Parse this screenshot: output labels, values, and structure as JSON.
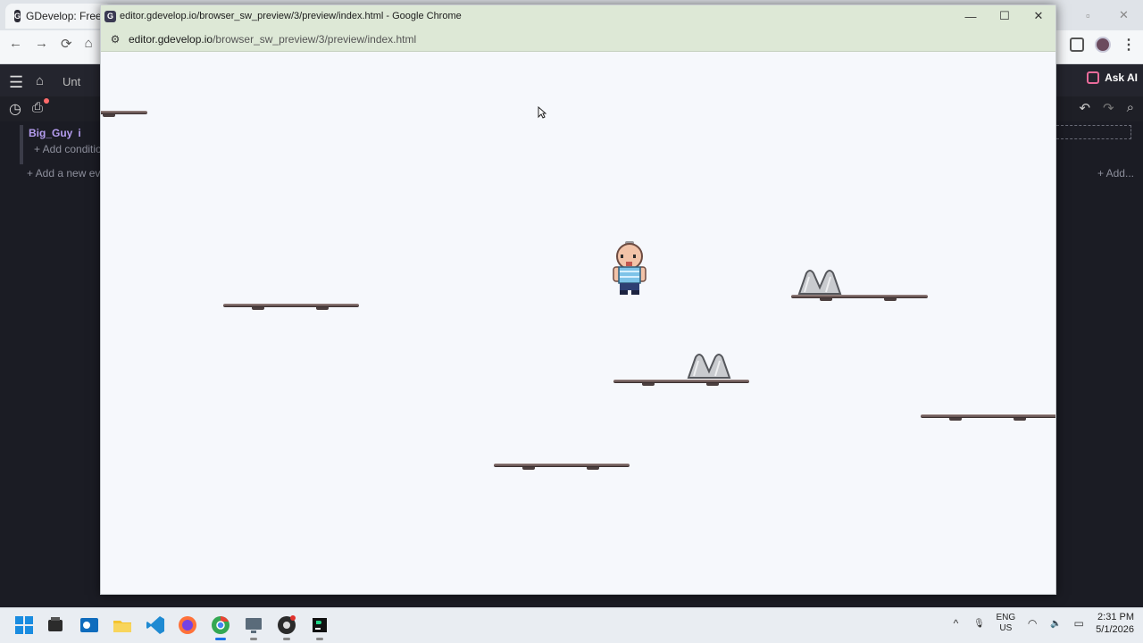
{
  "background_browser": {
    "tab_title": "GDevelop: Free, F",
    "favicon_letter": "G",
    "nav_back": "←",
    "nav_forward": "→",
    "nav_reload": "⟳",
    "nav_home": "⌂",
    "window_controls": [
      "▫",
      "✕"
    ],
    "menu_icon": "⋮"
  },
  "gdevelop": {
    "menu_icon": "☰",
    "home_icon": "⌂",
    "scene_tab_label": "Unt",
    "ask_ai_label": "Ask AI",
    "history_icon": "◷",
    "save_icon": "⎙",
    "undo_icon": "↶",
    "redo_icon": "↷",
    "search_icon": "⌕",
    "event_object": "Big_Guy",
    "event_suffix": "i",
    "add_condition": "+ Add conditio",
    "add_event": "+ Add a new ev",
    "add_action_right": "+ Add..."
  },
  "preview_window": {
    "favicon_letter": "G",
    "title": "editor.gdevelop.io/browser_sw_preview/3/preview/index.html - Google Chrome",
    "url_domain": "editor.gdevelop.io",
    "url_path": "/browser_sw_preview/3/preview/index.html",
    "site_info_icon": "⚙",
    "controls": {
      "minimize": "—",
      "maximize": "☐",
      "close": "✕"
    }
  },
  "taskbar": {
    "language": "ENG",
    "region": "US",
    "time": "2:31 PM",
    "date": "5/1/2026",
    "tray_chevron": "^",
    "mic_icon": "🎙",
    "wifi_icon": "◠",
    "speaker_icon": "🔈",
    "battery_icon": "▭",
    "apps": [
      "windows-start",
      "file-manager",
      "outlook",
      "file-explorer",
      "vs-code",
      "firefox",
      "chrome",
      "remote-desktop",
      "obs",
      "pycharm"
    ]
  },
  "colors": {
    "editor_bg": "#1b1c24",
    "preview_chrome": "#dde8d6",
    "game_bg": "#f6f8fc",
    "platform": "#6e5b59",
    "accent_purple": "#b59df0"
  }
}
